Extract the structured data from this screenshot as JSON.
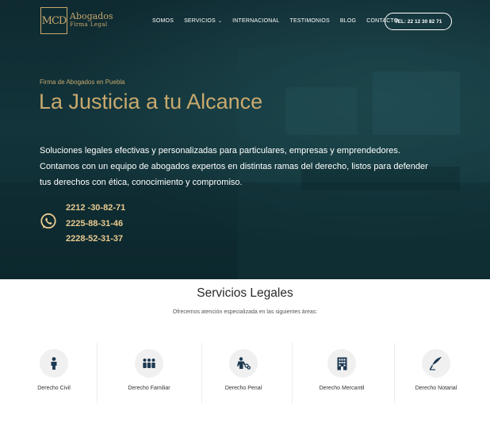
{
  "header": {
    "logo_initials": "MCD",
    "logo_name": "Abogados",
    "logo_sub": "Firma Legal",
    "nav": [
      {
        "label": "SOMOS"
      },
      {
        "label": "SERVICIOS"
      },
      {
        "label": "INTERNACIONAL"
      },
      {
        "label": "TESTIMONIOS"
      },
      {
        "label": "BLOG"
      },
      {
        "label": "CONTACTO"
      }
    ],
    "phone_button": "TEL: 22 12 30 82 71"
  },
  "hero": {
    "eyebrow": "Firma de Abogados en Puebla",
    "headline": "La Justicia a tu Alcance",
    "lead": [
      "Soluciones legales efectivas y personalizadas para particulares, empresas y emprendedores.",
      "Contamos con un equipo de abogados expertos en distintas ramas del derecho, listos para defender",
      "tus derechos con ética, conocimiento y compromiso."
    ],
    "phones": [
      "2212 -30-82-71",
      "2225-88-31-46",
      "2228-52-31-37"
    ],
    "whatsapp_icon": "whatsapp-icon"
  },
  "services_section": {
    "title": "Servicios Legales",
    "subtitle": "Ofrecemos atención especializada en las siguientes áreas:",
    "items": [
      {
        "label": "Derecho Civil",
        "icon": "person-icon"
      },
      {
        "label": "Derecho Familiar",
        "icon": "family-icon"
      },
      {
        "label": "Derecho Penal",
        "icon": "handcuffs-person-icon"
      },
      {
        "label": "Derecho Mercantil",
        "icon": "building-icon"
      },
      {
        "label": "Derecho Notarial",
        "icon": "pen-icon"
      }
    ]
  },
  "colors": {
    "accent_gold": "#c9a96e",
    "hero_bg": "#12343a",
    "icon_navy": "#1e3a52"
  }
}
